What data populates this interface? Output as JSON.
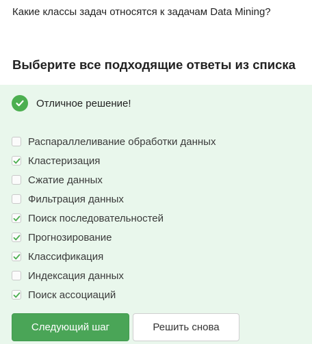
{
  "question": {
    "text": "Какие классы задач относятся к задачам Data Mining?"
  },
  "prompt": {
    "title": "Выберите все подходящие ответы из списка"
  },
  "result": {
    "icon": "checkmark-circle-icon",
    "text": "Отличное решение!",
    "color": "#4caf50"
  },
  "options": [
    {
      "label": "Распараллеливание обработки данных",
      "checked": false
    },
    {
      "label": "Кластеризация",
      "checked": true
    },
    {
      "label": "Сжатие данных",
      "checked": false
    },
    {
      "label": "Фильтрация данных",
      "checked": false
    },
    {
      "label": "Поиск последовательностей",
      "checked": true
    },
    {
      "label": "Прогнозирование",
      "checked": true
    },
    {
      "label": "Классификация",
      "checked": true
    },
    {
      "label": "Индексация данных",
      "checked": false
    },
    {
      "label": "Поиск ассоциаций",
      "checked": true
    }
  ],
  "buttons": {
    "next_label": "Следующий шаг",
    "retry_label": "Решить снова"
  },
  "colors": {
    "panel_background": "#e9f7ec",
    "primary_button": "#4aa557",
    "checkmark": "#4caf50"
  }
}
